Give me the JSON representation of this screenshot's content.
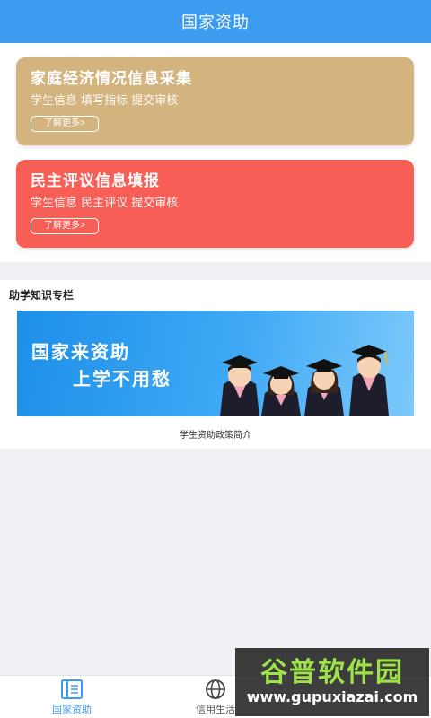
{
  "header": {
    "title": "国家资助"
  },
  "cards": [
    {
      "title": "家庭经济情况信息采集",
      "subtitle": "学生信息  填写指标  提交审核",
      "button": "了解更多>",
      "color": "#d3b37e"
    },
    {
      "title": "民主评议信息填报",
      "subtitle": "学生信息  民主评议  提交审核",
      "button": "了解更多>",
      "color": "#f75f56"
    }
  ],
  "knowledge": {
    "title": "助学知识专栏",
    "banner": {
      "line1": "国家来资助",
      "line2": "上学不用愁"
    },
    "caption": "学生资助政策简介"
  },
  "tabbar": {
    "tabs": [
      {
        "label": "国家资助",
        "icon": "book-icon",
        "active": true
      },
      {
        "label": "信用生活",
        "icon": "globe-icon",
        "active": false
      },
      {
        "label": "",
        "icon": "",
        "active": false
      }
    ]
  },
  "watermark": {
    "main": "谷普软件园",
    "sub": "www.gupuxiazai.com"
  },
  "colors": {
    "primary": "#3d9bf0",
    "background": "#efeff4"
  }
}
